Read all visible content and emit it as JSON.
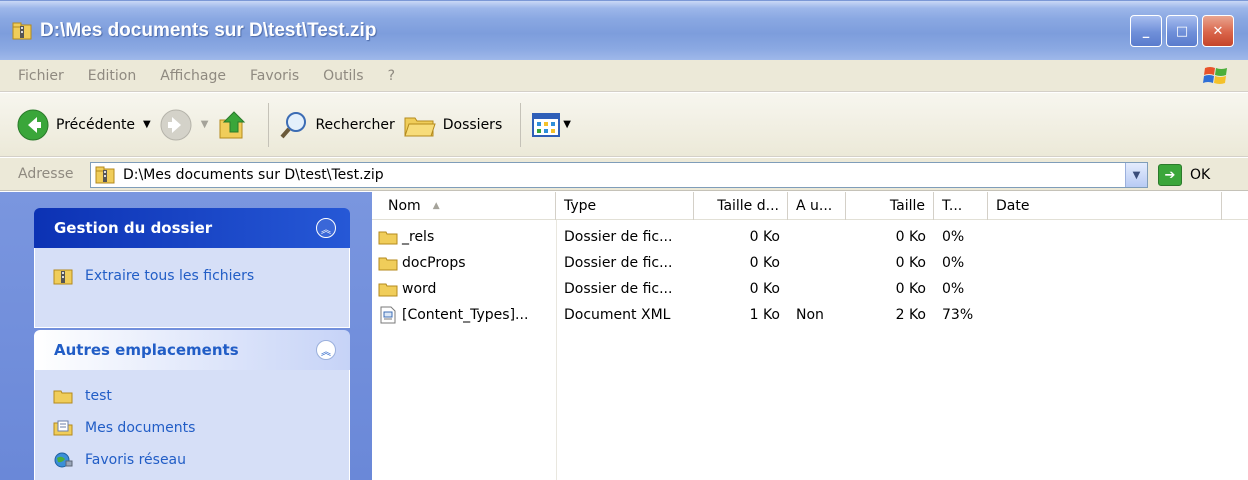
{
  "window": {
    "title": "D:\\Mes documents sur D\\test\\Test.zip",
    "min_label": "_",
    "max_label": "□",
    "close_label": "✕"
  },
  "menu": {
    "items": [
      "Fichier",
      "Edition",
      "Affichage",
      "Favoris",
      "Outils",
      "?"
    ]
  },
  "toolbar": {
    "back_label": "Précédente",
    "search_label": "Rechercher",
    "folders_label": "Dossiers"
  },
  "address": {
    "label": "Adresse",
    "value": "D:\\Mes documents sur D\\test\\Test.zip",
    "go_label": "OK"
  },
  "taskpane": {
    "folder_tasks": {
      "title": "Gestion du dossier",
      "items": [
        {
          "label": "Extraire tous les fichiers",
          "icon": "zip-folder-icon"
        }
      ]
    },
    "other_places": {
      "title": "Autres emplacements",
      "items": [
        {
          "label": "test",
          "icon": "folder-icon"
        },
        {
          "label": "Mes documents",
          "icon": "my-documents-icon"
        },
        {
          "label": "Favoris réseau",
          "icon": "network-places-icon"
        }
      ]
    }
  },
  "filelist": {
    "columns": [
      "Nom",
      "Type",
      "Taille d...",
      "A u...",
      "Taille",
      "T...",
      "Date"
    ],
    "rows": [
      {
        "name": "_rels",
        "type": "Dossier de fic...",
        "packed": "0 Ko",
        "pwd": "",
        "size": "0 Ko",
        "ratio": "0%",
        "date": "",
        "icon": "folder-icon"
      },
      {
        "name": "docProps",
        "type": "Dossier de fic...",
        "packed": "0 Ko",
        "pwd": "",
        "size": "0 Ko",
        "ratio": "0%",
        "date": "",
        "icon": "folder-icon"
      },
      {
        "name": "word",
        "type": "Dossier de fic...",
        "packed": "0 Ko",
        "pwd": "",
        "size": "0 Ko",
        "ratio": "0%",
        "date": "",
        "icon": "folder-icon"
      },
      {
        "name": "[Content_Types]...",
        "type": "Document XML",
        "packed": "1 Ko",
        "pwd": "Non",
        "size": "2 Ko",
        "ratio": "73%",
        "date": "",
        "icon": "xml-file-icon"
      }
    ]
  },
  "colors": {
    "titlebar": "#8aa8e2",
    "taskpane": "#7a96df",
    "link": "#215dc6"
  }
}
